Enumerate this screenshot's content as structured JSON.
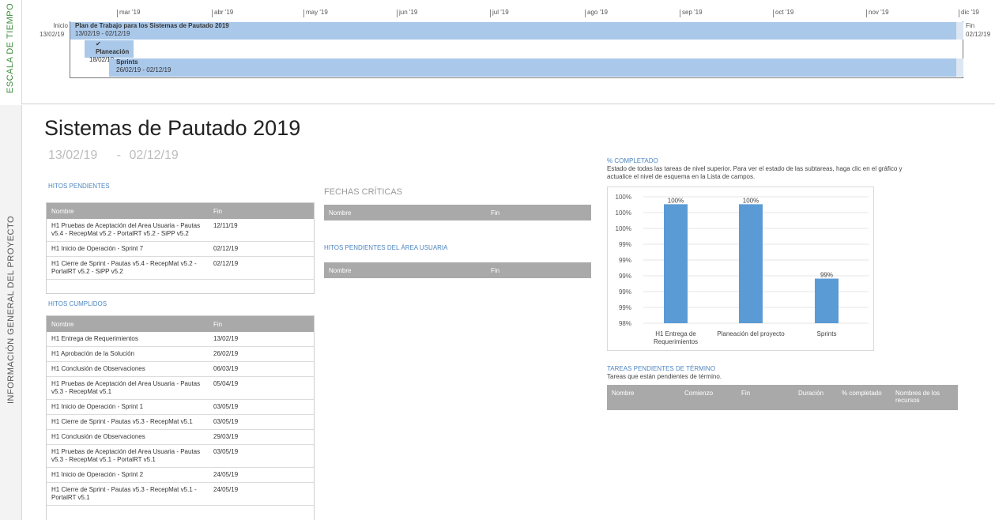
{
  "timeline": {
    "side_label": "ESCALA DE TIEMPO",
    "months": [
      "mar '19",
      "abr '19",
      "may '19",
      "jun '19",
      "jul '19",
      "ago '19",
      "sep '19",
      "oct '19",
      "nov '19",
      "dic '19"
    ],
    "start_label": "Inicio",
    "start_date": "13/02/19",
    "end_label": "Fin",
    "end_date": "02/12/19",
    "bars": [
      {
        "title": "Plan de Trabajo para los Sistemas de Pautado 2019",
        "dates": "13/02/19 - 02/12/19"
      },
      {
        "title": "Planeación",
        "dates": "18/02/19 -",
        "check": "✔"
      },
      {
        "title": "Sprints",
        "dates": "26/02/19 - 02/12/19"
      }
    ]
  },
  "overview": {
    "side_label": "INFORMACIÓN GENERAL DEL PROYECTO",
    "title": "Sistemas de Pautado 2019",
    "start": "13/02/19",
    "separator": "-",
    "end": "02/12/19"
  },
  "hitos_pendientes": {
    "heading": "HITOS PENDIENTES",
    "columns": [
      "Nombre",
      "Fin"
    ],
    "rows": [
      [
        "H1 Pruebas de Aceptación del Area Usuaria - Pautas v5.4 - RecepMat v5.2 - PortalRT v5.2 - SiPP v5.2",
        "12/11/19"
      ],
      [
        "H1 Inicio de Operación - Sprint 7",
        "02/12/19"
      ],
      [
        "H1 Cierre de Sprint - Pautas v5.4 - RecepMat v5.2 - PortalRT v5.2 - SiPP v5.2",
        "02/12/19"
      ]
    ]
  },
  "hitos_cumplidos": {
    "heading": "HITOS CUMPLIDOS",
    "columns": [
      "Nombre",
      "Fin"
    ],
    "rows": [
      [
        "H1 Entrega de Requerimientos",
        "13/02/19"
      ],
      [
        "H1 Aprobación de la Solución",
        "26/02/19"
      ],
      [
        "H1 Conclusión de Observaciones",
        "06/03/19"
      ],
      [
        "H1 Pruebas de Aceptación del Area Usuaria - Pautas v5.3 - RecepMat v5.1",
        "05/04/19"
      ],
      [
        "H1 Inicio de Operación - Sprint 1",
        "03/05/19"
      ],
      [
        "H1 Cierre de Sprint - Pautas v5.3 - RecepMat v5.1",
        "03/05/19"
      ],
      [
        "H1 Conclusión de Observaciones",
        "29/03/19"
      ],
      [
        "H1 Pruebas de Aceptación del Area Usuaria - Pautas v5.3 - RecepMat v5.1 - PortalRT v5.1",
        "03/05/19"
      ],
      [
        "H1 Inicio de Operación - Sprint 2",
        "24/05/19"
      ],
      [
        "H1 Cierre de Sprint - Pautas v5.3 - RecepMat v5.1 - PortalRT v5.1",
        "24/05/19"
      ]
    ]
  },
  "fechas_criticas": {
    "heading": "FECHAS CRÍTICAS",
    "columns": [
      "Nombre",
      "Fin"
    ]
  },
  "hitos_area_usuaria": {
    "heading": "HITOS PENDIENTES DEL ÁREA USUARIA",
    "columns": [
      "Nombre",
      "Fin"
    ]
  },
  "completado": {
    "heading": "% COMPLETADO",
    "description": "Estado de todas las tareas de nivel superior. Para ver el estado de las subtareas, haga clic en el gráfico y actualice el nivel de esquema en la Lista de campos."
  },
  "chart_data": {
    "type": "bar",
    "categories": [
      "H1 Entrega de Requerimientos",
      "Planeación del proyecto",
      "Sprints"
    ],
    "values": [
      100,
      100,
      99
    ],
    "data_labels": [
      "100%",
      "100%",
      "99%"
    ],
    "y_tick_labels": [
      "100%",
      "100%",
      "100%",
      "99%",
      "99%",
      "99%",
      "99%",
      "99%",
      "98%"
    ],
    "ylim": [
      98.4,
      100.1
    ],
    "bar_color": "#5b9bd5",
    "grid": true
  },
  "tareas_pendientes": {
    "heading": "TAREAS PENDIENTES DE TÉRMINO",
    "description": "Tareas que están pendientes de término.",
    "columns": [
      "Nombre",
      "Comienzo",
      "Fin",
      "Duración",
      "% completado",
      "Nombres de los recursos"
    ]
  },
  "colors": {
    "accent_blue": "#4e86c0",
    "bar_blue": "#a9c8ea",
    "header_gray": "#a9a9a9",
    "side_label_green": "#3b8b3b"
  }
}
